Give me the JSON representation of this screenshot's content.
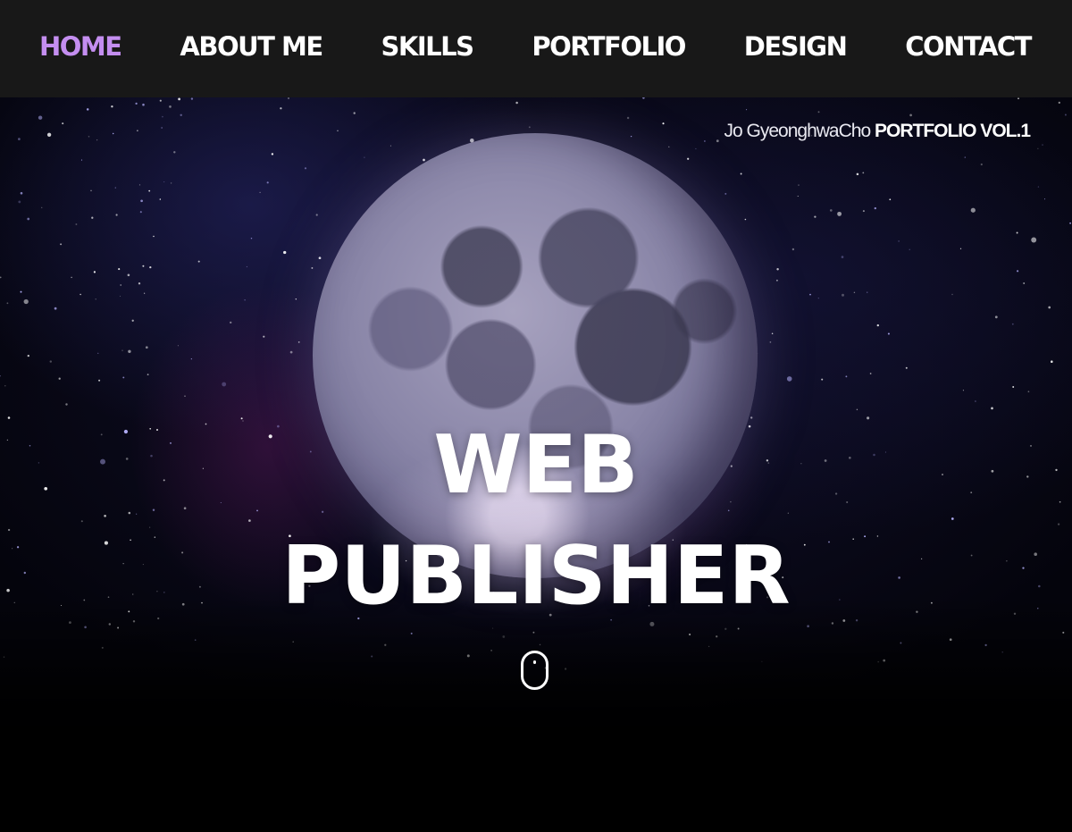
{
  "nav": {
    "items": [
      {
        "label": "HOME",
        "active": true
      },
      {
        "label": "ABOUT ME",
        "active": false
      },
      {
        "label": "SKILLS",
        "active": false
      },
      {
        "label": "PORTFOLIO",
        "active": false
      },
      {
        "label": "DESIGN",
        "active": false
      },
      {
        "label": "CONTACT",
        "active": false
      }
    ],
    "active_color": "#c48ef0",
    "background": "#181818"
  },
  "hero": {
    "tagline_name": "Jo GyeonghwaCho",
    "tagline_title": "PORTFOLIO VOL.1",
    "headline_line1": "WEB",
    "headline_line2": "PUBLISHER",
    "scroll_icon": "mouse-scroll-icon"
  }
}
